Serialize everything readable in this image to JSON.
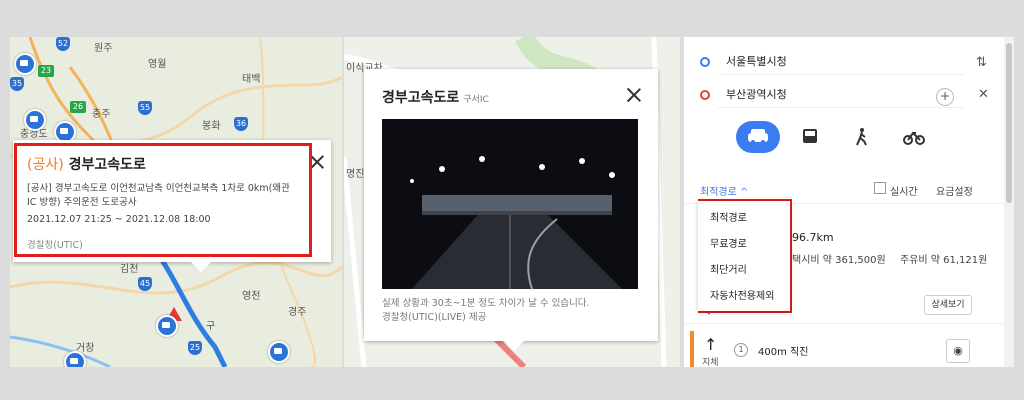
{
  "panel1": {
    "map_labels": [
      "원주",
      "영월",
      "태백",
      "충주",
      "봉화",
      "충청도",
      "영천",
      "경주",
      "거창",
      "김천",
      "구"
    ],
    "highway_numbers": [
      "52",
      "23",
      "35",
      "55",
      "26",
      "36",
      "45",
      "25",
      "35"
    ],
    "popup": {
      "tag": "(공사)",
      "title": "경부고속도로",
      "description": "[공사] 경부고속도로 이언천교남측 이언천교북측 1차로 0km(왜관IC 방향) 주의운전 도로공사",
      "period": "2021.12.07 21:25 ~ 2021.12.08 18:00",
      "source": "경찰청(UTIC)"
    }
  },
  "panel2": {
    "map_labels": [
      "이식교차",
      "명진"
    ],
    "popup": {
      "title": "경부고속도로",
      "subtitle": "구서IC",
      "note_line1": "실제 상황과 30초~1분 정도 차이가 날 수 있습니다.",
      "note_line2": "경찰청(UTIC)(LIVE) 제공"
    }
  },
  "panel3": {
    "origin": "서울특별시청",
    "destination": "부산광역시청",
    "modes": [
      "car-icon",
      "bus-icon",
      "walk-icon",
      "bike-icon"
    ],
    "route_option": "최적경로",
    "realtime_label": "실시간",
    "fare_settings": "요금설정",
    "dropdown_options": [
      "최적경로",
      "무료경로",
      "최단거리",
      "자동차전용제외"
    ],
    "distance_partial": "96.7km",
    "taxi_fare": "택시비 약 361,500원",
    "fuel_cost": "주유비 약 61,121원",
    "details_button": "상세보기",
    "step_index": "1",
    "step_text": "400m 직진",
    "step_label": "지체",
    "accent": "#3b7cf0"
  }
}
